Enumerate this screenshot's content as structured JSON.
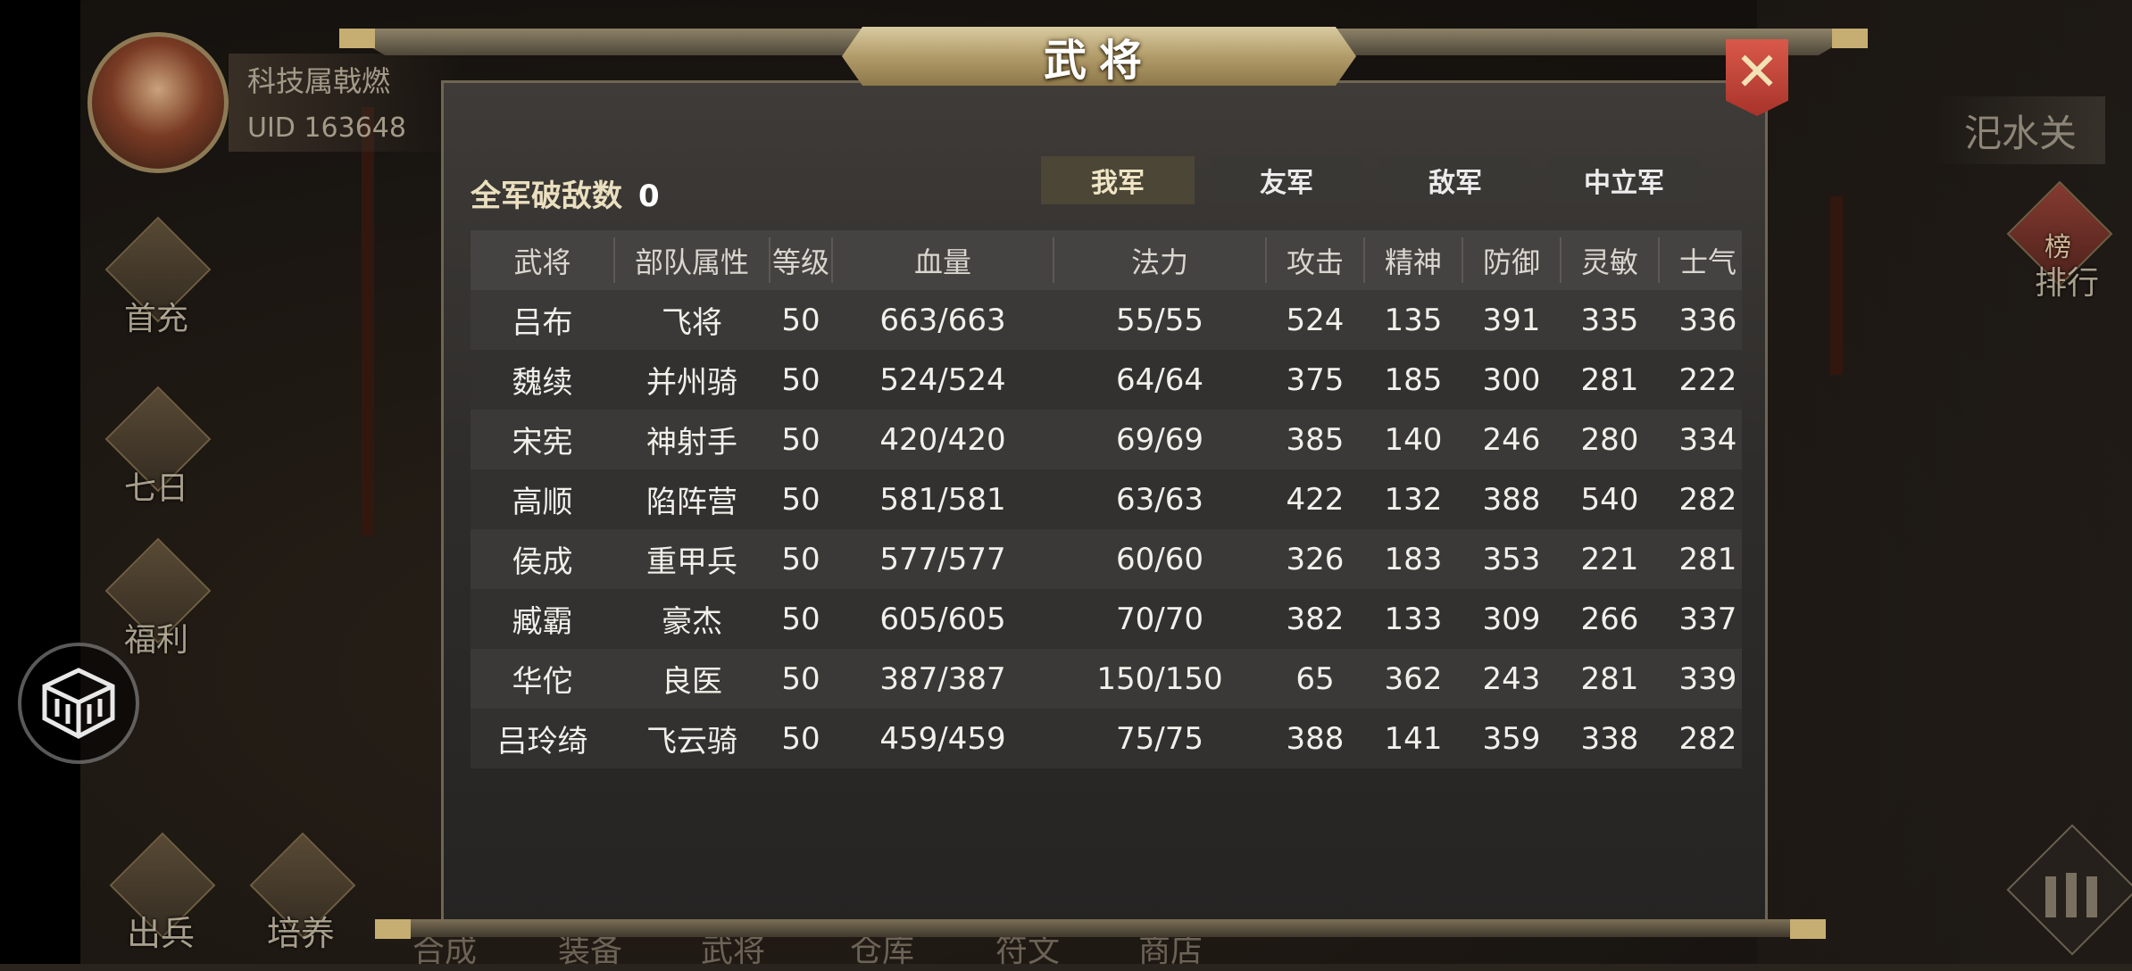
{
  "background": {
    "player_name": "科技属戟燃",
    "player_uid": "UID 163648",
    "side_buttons": [
      "首充",
      "七日",
      "福利"
    ],
    "bottom_buttons": [
      "出兵",
      "培养"
    ],
    "bottom_faded": [
      "合成",
      "装备",
      "武将",
      "仓库",
      "符文",
      "商店"
    ],
    "location": "汜水关",
    "rank_label": "排行",
    "rank_badge": "榜"
  },
  "dialog": {
    "title": "武将",
    "close": "✕",
    "kill_count_label": "全军破敌数",
    "kill_count_value": "0",
    "tabs": [
      "我军",
      "友军",
      "敌军",
      "中立军"
    ],
    "active_tab": 0
  },
  "table": {
    "headers": [
      "武将",
      "部队属性",
      "等级",
      "血量",
      "法力",
      "攻击",
      "精神",
      "防御",
      "灵敏",
      "士气"
    ],
    "rows": [
      [
        "吕布",
        "飞将",
        "50",
        "663/663",
        "55/55",
        "524",
        "135",
        "391",
        "335",
        "336"
      ],
      [
        "魏续",
        "并州骑",
        "50",
        "524/524",
        "64/64",
        "375",
        "185",
        "300",
        "281",
        "222"
      ],
      [
        "宋宪",
        "神射手",
        "50",
        "420/420",
        "69/69",
        "385",
        "140",
        "246",
        "280",
        "334"
      ],
      [
        "高顺",
        "陷阵营",
        "50",
        "581/581",
        "63/63",
        "422",
        "132",
        "388",
        "540",
        "282"
      ],
      [
        "侯成",
        "重甲兵",
        "50",
        "577/577",
        "60/60",
        "326",
        "183",
        "353",
        "221",
        "281"
      ],
      [
        "臧霸",
        "豪杰",
        "50",
        "605/605",
        "70/70",
        "382",
        "133",
        "309",
        "266",
        "337"
      ],
      [
        "华佗",
        "良医",
        "50",
        "387/387",
        "150/150",
        "65",
        "362",
        "243",
        "281",
        "339"
      ],
      [
        "吕玲绮",
        "飞云骑",
        "50",
        "459/459",
        "75/75",
        "388",
        "141",
        "359",
        "338",
        "282"
      ]
    ]
  }
}
